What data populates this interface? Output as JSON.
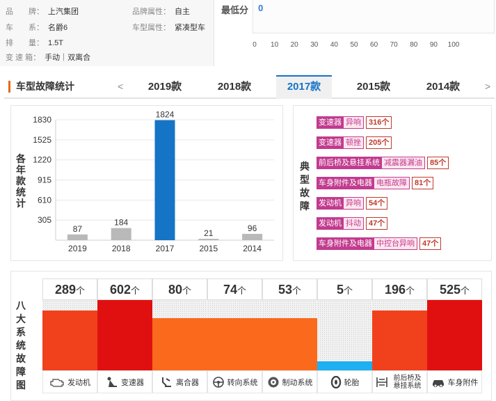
{
  "car_info": {
    "rows": [
      {
        "k1": "品　　牌：",
        "v1": "上汽集团",
        "k2": "品牌属性：",
        "v2": "自主"
      },
      {
        "k1": "车　　系：",
        "v1": "名爵6",
        "k2": "车型属性：",
        "v2": "紧凑型车"
      },
      {
        "k1": "排　　量：",
        "v1": "1.5T",
        "k2": "",
        "v2": ""
      },
      {
        "k1": "变 速 箱：",
        "v1": "手动｜双离合",
        "k2": "",
        "v2": ""
      }
    ]
  },
  "score": {
    "label": "最低分",
    "value": "0",
    "ticks": [
      "0",
      "10",
      "20",
      "30",
      "40",
      "50",
      "60",
      "70",
      "80",
      "90",
      "100"
    ]
  },
  "tabs": {
    "title": "车型故障统计",
    "prev": "<",
    "next": ">",
    "items": [
      "2019款",
      "2018款",
      "2017款",
      "2015款",
      "2014款"
    ],
    "active_index": 2
  },
  "chart_data": {
    "type": "bar",
    "ylabel": "各年款统计",
    "categories": [
      "2019",
      "2018",
      "2017",
      "2015",
      "2014"
    ],
    "values": [
      87,
      184,
      1824,
      21,
      96
    ],
    "yticks": [
      305,
      610,
      915,
      1220,
      1525,
      1830
    ],
    "ylim": [
      0,
      1830
    ],
    "highlight_index": 2,
    "colors": {
      "normal": "#b9b9b9",
      "highlight": "#1574c6"
    }
  },
  "typical_faults": {
    "title": "典型故障",
    "items": [
      {
        "category": "变速器",
        "type": "异响",
        "count": "316个"
      },
      {
        "category": "变速器",
        "type": "顿挫",
        "count": "205个"
      },
      {
        "category": "前后桥及悬挂系统",
        "type": "减震器漏油",
        "count": "85个"
      },
      {
        "category": "车身附件及电器",
        "type": "电瓶故障",
        "count": "81个"
      },
      {
        "category": "发动机",
        "type": "异响",
        "count": "54个"
      },
      {
        "category": "发动机",
        "type": "抖动",
        "count": "47个"
      },
      {
        "category": "车身附件及电器",
        "type": "中控台异响",
        "count": "47个"
      }
    ]
  },
  "eight_faults": {
    "title": "八大系统故障图",
    "unit": "个",
    "columns": [
      {
        "count": "289",
        "label": "发动机",
        "level": 0.85,
        "color": "#f0411c",
        "icon": "engine-icon"
      },
      {
        "count": "602",
        "label": "变速器",
        "level": 1.0,
        "color": "#e01010",
        "icon": "gear-shift-icon"
      },
      {
        "count": "80",
        "label": "离合器",
        "level": 0.74,
        "color": "#fb6a1c",
        "icon": "clutch-pedal-icon"
      },
      {
        "count": "74",
        "label": "转向系统",
        "level": 0.74,
        "color": "#fb6a1c",
        "icon": "steering-wheel-icon"
      },
      {
        "count": "53",
        "label": "制动系统",
        "level": 0.74,
        "color": "#fb6a1c",
        "icon": "brake-disc-icon"
      },
      {
        "count": "5",
        "label": "轮胎",
        "level": 0.13,
        "color": "#1eb0f0",
        "icon": "tire-icon"
      },
      {
        "count": "196",
        "label": "前后桥及悬挂系统",
        "level": 0.85,
        "color": "#f0411c",
        "icon": "suspension-icon"
      },
      {
        "count": "525",
        "label": "车身附件",
        "level": 1.0,
        "color": "#e01010",
        "icon": "car-body-icon"
      }
    ]
  }
}
